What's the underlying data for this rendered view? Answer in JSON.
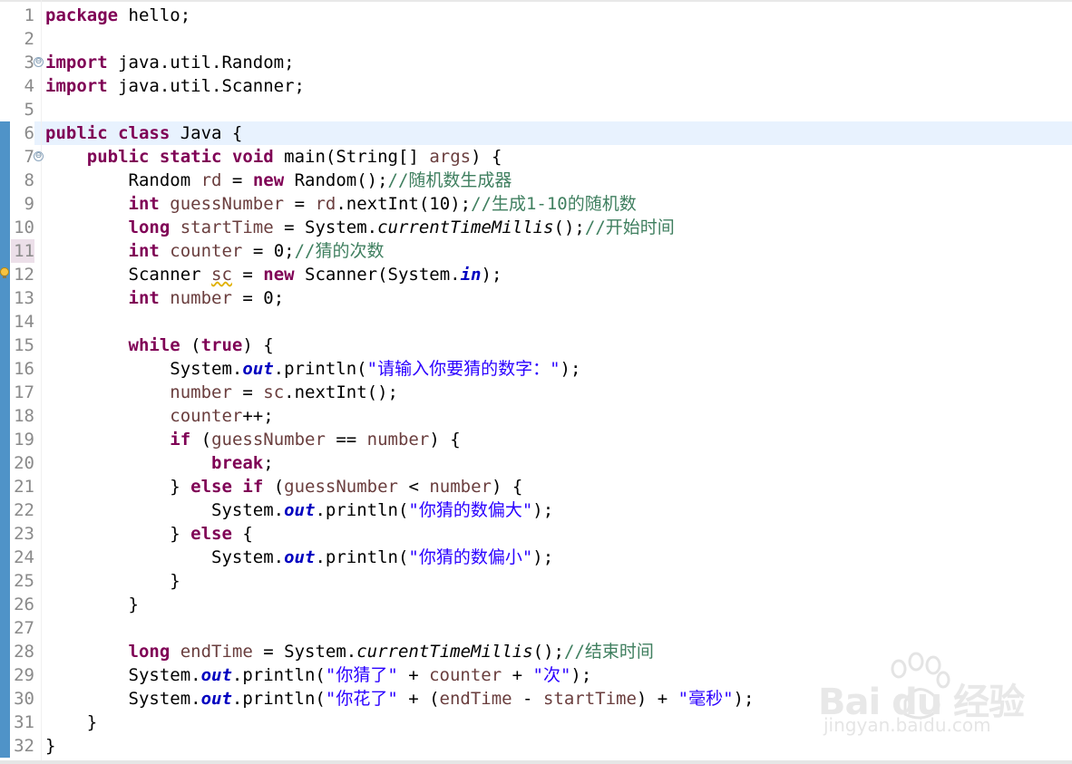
{
  "editor": {
    "lines": [
      {
        "n": "1",
        "tokens": [
          {
            "t": "package",
            "c": "k"
          },
          {
            "t": " hello;"
          }
        ]
      },
      {
        "n": "2",
        "tokens": []
      },
      {
        "n": "3",
        "tokens": [
          {
            "t": "import",
            "c": "k"
          },
          {
            "t": " java.util.Random;"
          }
        ],
        "fold": "⊖"
      },
      {
        "n": "4",
        "tokens": [
          {
            "t": "import",
            "c": "k"
          },
          {
            "t": " java.util.Scanner;"
          }
        ]
      },
      {
        "n": "5",
        "tokens": []
      },
      {
        "n": "6",
        "tokens": [
          {
            "t": "public",
            "c": "k"
          },
          {
            "t": " "
          },
          {
            "t": "class",
            "c": "k"
          },
          {
            "t": " Java {"
          }
        ]
      },
      {
        "n": "7",
        "tokens": [
          {
            "t": "    "
          },
          {
            "t": "public",
            "c": "k"
          },
          {
            "t": " "
          },
          {
            "t": "static",
            "c": "k"
          },
          {
            "t": " "
          },
          {
            "t": "void",
            "c": "k"
          },
          {
            "t": " main(String[] "
          },
          {
            "t": "args",
            "c": "v"
          },
          {
            "t": ") {"
          }
        ],
        "fold": "⊖"
      },
      {
        "n": "8",
        "tokens": [
          {
            "t": "        Random "
          },
          {
            "t": "rd",
            "c": "v"
          },
          {
            "t": " = "
          },
          {
            "t": "new",
            "c": "k"
          },
          {
            "t": " Random();"
          },
          {
            "t": "//随机数生成器",
            "c": "c"
          }
        ]
      },
      {
        "n": "9",
        "tokens": [
          {
            "t": "        "
          },
          {
            "t": "int",
            "c": "k"
          },
          {
            "t": " "
          },
          {
            "t": "guessNumber",
            "c": "v"
          },
          {
            "t": " = "
          },
          {
            "t": "rd",
            "c": "v"
          },
          {
            "t": ".nextInt(10);"
          },
          {
            "t": "//生成1-10的随机数",
            "c": "c"
          }
        ]
      },
      {
        "n": "10",
        "tokens": [
          {
            "t": "        "
          },
          {
            "t": "long",
            "c": "k"
          },
          {
            "t": " "
          },
          {
            "t": "startTime",
            "c": "v"
          },
          {
            "t": " = System."
          },
          {
            "t": "currentTimeMillis",
            "c": "m"
          },
          {
            "t": "();"
          },
          {
            "t": "//开始时间",
            "c": "c"
          }
        ]
      },
      {
        "n": "11",
        "tokens": [
          {
            "t": "        "
          },
          {
            "t": "int",
            "c": "k"
          },
          {
            "t": " "
          },
          {
            "t": "counter",
            "c": "v"
          },
          {
            "t": " = 0;"
          },
          {
            "t": "//猜的次数",
            "c": "c"
          }
        ]
      },
      {
        "n": "12",
        "tokens": [
          {
            "t": "        Scanner "
          },
          {
            "t": "sc",
            "c": "v squiggle"
          },
          {
            "t": " = "
          },
          {
            "t": "new",
            "c": "k"
          },
          {
            "t": " Scanner(System."
          },
          {
            "t": "in",
            "c": "f"
          },
          {
            "t": ");"
          }
        ],
        "warning": true
      },
      {
        "n": "13",
        "tokens": [
          {
            "t": "        "
          },
          {
            "t": "int",
            "c": "k"
          },
          {
            "t": " "
          },
          {
            "t": "number",
            "c": "v"
          },
          {
            "t": " = 0;"
          }
        ]
      },
      {
        "n": "14",
        "tokens": []
      },
      {
        "n": "15",
        "tokens": [
          {
            "t": "        "
          },
          {
            "t": "while",
            "c": "k"
          },
          {
            "t": " ("
          },
          {
            "t": "true",
            "c": "k"
          },
          {
            "t": ") {"
          }
        ]
      },
      {
        "n": "16",
        "tokens": [
          {
            "t": "            System."
          },
          {
            "t": "out",
            "c": "f"
          },
          {
            "t": ".println("
          },
          {
            "t": "\"请输入你要猜的数字：\"",
            "c": "s"
          },
          {
            "t": ");"
          }
        ]
      },
      {
        "n": "17",
        "tokens": [
          {
            "t": "            "
          },
          {
            "t": "number",
            "c": "v"
          },
          {
            "t": " = "
          },
          {
            "t": "sc",
            "c": "v"
          },
          {
            "t": ".nextInt();"
          }
        ]
      },
      {
        "n": "18",
        "tokens": [
          {
            "t": "            "
          },
          {
            "t": "counter",
            "c": "v"
          },
          {
            "t": "++;"
          }
        ]
      },
      {
        "n": "19",
        "tokens": [
          {
            "t": "            "
          },
          {
            "t": "if",
            "c": "k"
          },
          {
            "t": " ("
          },
          {
            "t": "guessNumber",
            "c": "v"
          },
          {
            "t": " == "
          },
          {
            "t": "number",
            "c": "v"
          },
          {
            "t": ") {"
          }
        ]
      },
      {
        "n": "20",
        "tokens": [
          {
            "t": "                "
          },
          {
            "t": "break",
            "c": "k"
          },
          {
            "t": ";"
          }
        ]
      },
      {
        "n": "21",
        "tokens": [
          {
            "t": "            } "
          },
          {
            "t": "else",
            "c": "k"
          },
          {
            "t": " "
          },
          {
            "t": "if",
            "c": "k"
          },
          {
            "t": " ("
          },
          {
            "t": "guessNumber",
            "c": "v"
          },
          {
            "t": " < "
          },
          {
            "t": "number",
            "c": "v"
          },
          {
            "t": ") {"
          }
        ]
      },
      {
        "n": "22",
        "tokens": [
          {
            "t": "                System."
          },
          {
            "t": "out",
            "c": "f"
          },
          {
            "t": ".println("
          },
          {
            "t": "\"你猜的数偏大\"",
            "c": "s"
          },
          {
            "t": ");"
          }
        ]
      },
      {
        "n": "23",
        "tokens": [
          {
            "t": "            } "
          },
          {
            "t": "else",
            "c": "k"
          },
          {
            "t": " {"
          }
        ]
      },
      {
        "n": "24",
        "tokens": [
          {
            "t": "                System."
          },
          {
            "t": "out",
            "c": "f"
          },
          {
            "t": ".println("
          },
          {
            "t": "\"你猜的数偏小\"",
            "c": "s"
          },
          {
            "t": ");"
          }
        ]
      },
      {
        "n": "25",
        "tokens": [
          {
            "t": "            }"
          }
        ]
      },
      {
        "n": "26",
        "tokens": [
          {
            "t": "        }"
          }
        ]
      },
      {
        "n": "27",
        "tokens": []
      },
      {
        "n": "28",
        "tokens": [
          {
            "t": "        "
          },
          {
            "t": "long",
            "c": "k"
          },
          {
            "t": " "
          },
          {
            "t": "endTime",
            "c": "v"
          },
          {
            "t": " = System."
          },
          {
            "t": "currentTimeMillis",
            "c": "m"
          },
          {
            "t": "();"
          },
          {
            "t": "//结束时间",
            "c": "c"
          }
        ]
      },
      {
        "n": "29",
        "tokens": [
          {
            "t": "        System."
          },
          {
            "t": "out",
            "c": "f"
          },
          {
            "t": ".println("
          },
          {
            "t": "\"你猜了\"",
            "c": "s"
          },
          {
            "t": " + "
          },
          {
            "t": "counter",
            "c": "v"
          },
          {
            "t": " + "
          },
          {
            "t": "\"次\"",
            "c": "s"
          },
          {
            "t": ");"
          }
        ]
      },
      {
        "n": "30",
        "tokens": [
          {
            "t": "        System."
          },
          {
            "t": "out",
            "c": "f"
          },
          {
            "t": ".println("
          },
          {
            "t": "\"你花了\"",
            "c": "s"
          },
          {
            "t": " + ("
          },
          {
            "t": "endTime",
            "c": "v"
          },
          {
            "t": " - "
          },
          {
            "t": "startTime",
            "c": "v"
          },
          {
            "t": ") + "
          },
          {
            "t": "\"毫秒\"",
            "c": "s"
          },
          {
            "t": ");"
          }
        ]
      },
      {
        "n": "31",
        "tokens": [
          {
            "t": "    }"
          }
        ]
      },
      {
        "n": "32",
        "tokens": [
          {
            "t": "}"
          }
        ]
      }
    ],
    "current_line": "6",
    "selected_line_number": "11"
  },
  "watermark": {
    "logo_text": "Bai du 经验",
    "url": "jingyan.baidu.com"
  },
  "colors": {
    "keyword": "#7f0055",
    "string": "#2a00ff",
    "comment": "#3f7f5f",
    "static_field": "#0000c0",
    "local_variable": "#6a3e3e",
    "current_line_bg": "#e8f2fe",
    "overview_ruler": "#4f93c8"
  },
  "icons": {
    "fold": "collapse-circle-icon",
    "warning": "warning-bulb-icon"
  }
}
